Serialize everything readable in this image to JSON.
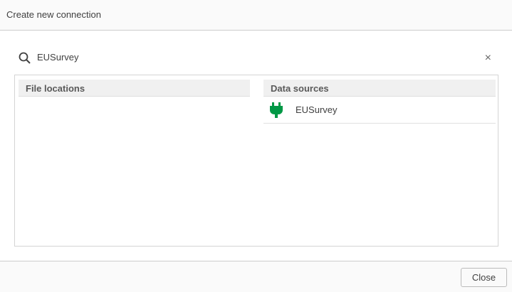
{
  "dialog": {
    "title": "Create new connection"
  },
  "search": {
    "value": "EUSurvey",
    "clear_icon": "×"
  },
  "file_locations": {
    "header": "File locations",
    "items": []
  },
  "data_sources": {
    "header": "Data sources",
    "items": [
      {
        "label": "EUSurvey",
        "icon": "plug-icon",
        "color": "#009845"
      }
    ]
  },
  "footer": {
    "close_label": "Close"
  }
}
